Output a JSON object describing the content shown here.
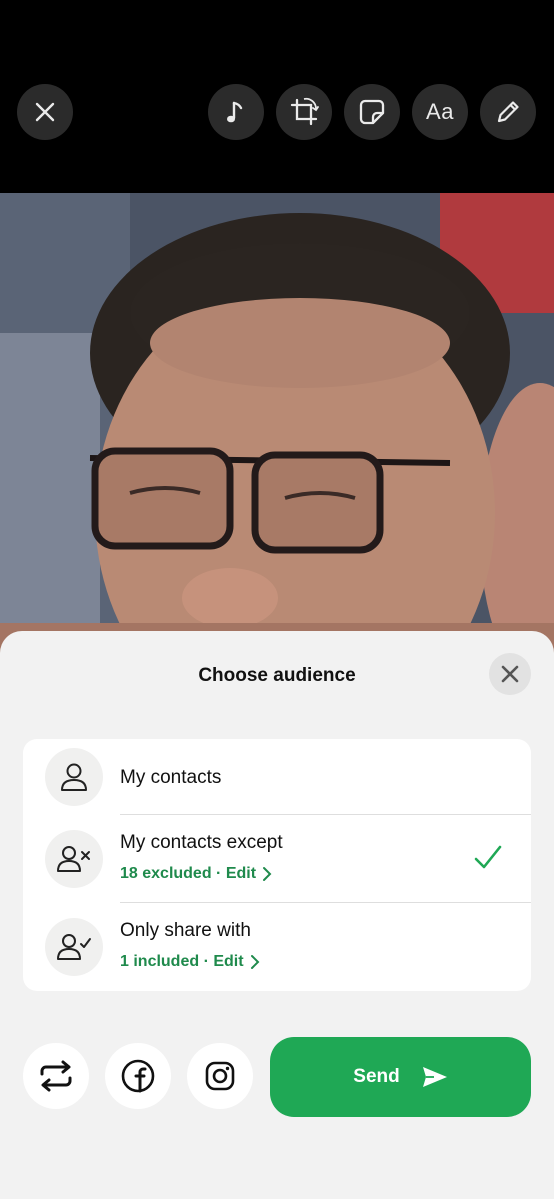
{
  "toolbar": {
    "close_icon": "close-icon",
    "buttons": [
      {
        "icon": "music-note-icon"
      },
      {
        "icon": "crop-rotate-icon"
      },
      {
        "icon": "sticker-icon"
      },
      {
        "icon": "text-icon",
        "label": "Aa"
      },
      {
        "icon": "pencil-icon"
      }
    ]
  },
  "sheet": {
    "title": "Choose audience",
    "options": [
      {
        "label": "My contacts",
        "icon": "person-icon",
        "selected": false
      },
      {
        "label": "My contacts except",
        "icon": "person-x-icon",
        "sub": "18 excluded · Edit",
        "selected": true
      },
      {
        "label": "Only share with",
        "icon": "person-check-icon",
        "sub": "1 included · Edit",
        "selected": false
      }
    ],
    "send_label": "Send"
  },
  "colors": {
    "accent": "#1fa855",
    "accent_text": "#1f8a4c",
    "sheet_bg": "#f2f2f2",
    "topbar_bg": "#000000"
  }
}
